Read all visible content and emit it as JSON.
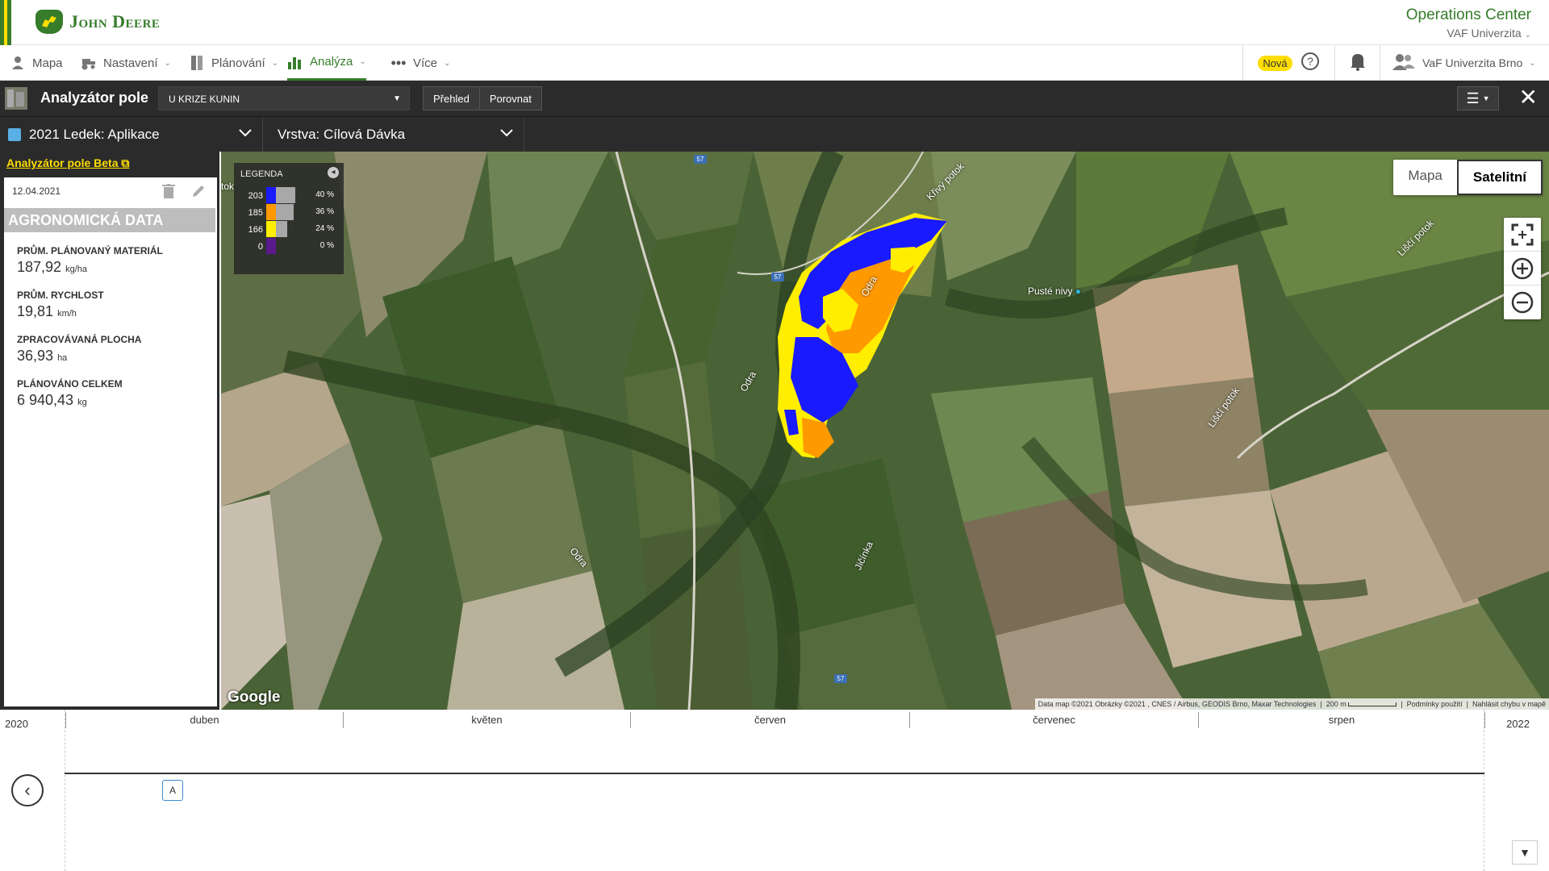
{
  "brand": {
    "name": "John Deere",
    "product": "Operations Center",
    "org": "VAF Univerzita"
  },
  "nav": {
    "items": [
      {
        "label": "Mapa"
      },
      {
        "label": "Nastavení"
      },
      {
        "label": "Plánování"
      },
      {
        "label": "Analýza"
      },
      {
        "label": "Více"
      }
    ],
    "new_badge": "Nová",
    "account": "VaF Univerzita Brno"
  },
  "analyzer": {
    "title": "Analyzátor pole",
    "field": "U KRIZE KUNIN",
    "tabs": [
      "Přehled",
      "Porovnat"
    ]
  },
  "selectors": {
    "operation": "2021 Ledek: Aplikace",
    "layer": "Vrstva: Cílová Dávka"
  },
  "panel": {
    "beta_link": "Analyzátor pole Beta",
    "date": "12.04.2021",
    "section": "AGRONOMICKÁ DATA",
    "metrics": [
      {
        "label": "PRŮM. PLÁNOVANÝ MATERIÁL",
        "value": "187,92",
        "unit": "kg/ha"
      },
      {
        "label": "PRŮM. RYCHLOST",
        "value": "19,81",
        "unit": "km/h"
      },
      {
        "label": "ZPRACOVÁVANÁ PLOCHA",
        "value": "36,93",
        "unit": "ha"
      },
      {
        "label": "PLÁNOVÁNO CELKEM",
        "value": "6 940,43",
        "unit": "kg"
      }
    ]
  },
  "legend": {
    "title": "LEGENDA",
    "rows": [
      {
        "value": "203",
        "color": "#1a1aff",
        "percent": "40 %",
        "fraction": 0.4
      },
      {
        "value": "185",
        "color": "#ff9900",
        "percent": "36 %",
        "fraction": 0.36
      },
      {
        "value": "166",
        "color": "#ffee00",
        "percent": "24 %",
        "fraction": 0.24
      },
      {
        "value": "0",
        "color": "#5b1a8c",
        "percent": "0 %",
        "fraction": 0.0
      }
    ]
  },
  "map": {
    "toggle": [
      "Mapa",
      "Satelitní"
    ],
    "labels": [
      "Křivý potok",
      "Liščí potok",
      "Liščí potok",
      "Odra",
      "Odra",
      "Odra",
      "Jičínka",
      "Pusté nivy",
      "tok"
    ],
    "road_number": "57",
    "google": "Google",
    "attribution": "Data map ©2021 Obrázky ©2021 , CNES / Airbus, GEODIS Brno, Maxar Technologies",
    "scale": "200 m",
    "terms": "Podmínky použití",
    "report": "Nahlásit chybu v mapě"
  },
  "timeline": {
    "start_year": "2020",
    "end_year": "2022",
    "months": [
      "duben",
      "květen",
      "červen",
      "červenec",
      "srpen"
    ],
    "marker": "A"
  },
  "colors": {
    "brand_green": "#367c2b",
    "brand_yellow": "#ffde00",
    "dark": "#2b2b2b"
  }
}
